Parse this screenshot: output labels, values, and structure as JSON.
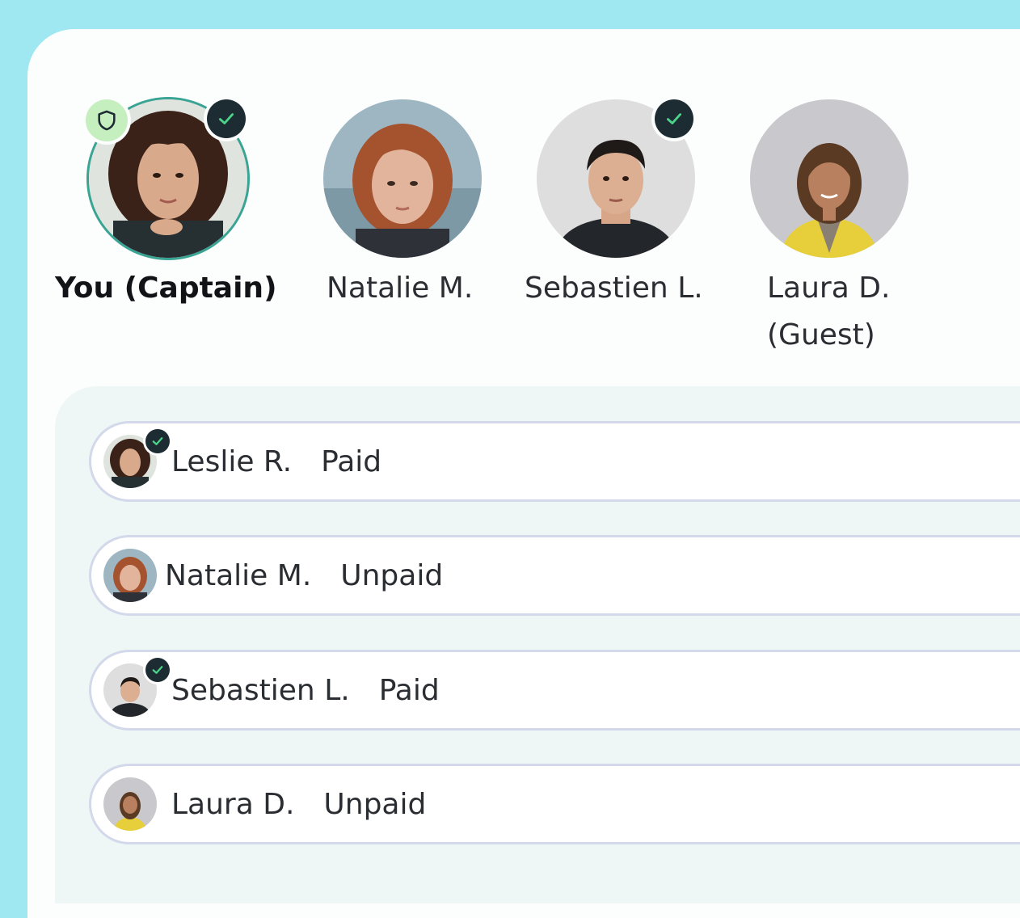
{
  "colors": {
    "frame": "#9fe8f1",
    "card": "#fcfdfd",
    "panel": "#eef7f6",
    "captain_ring": "#39a493",
    "badge_dark": "#1d2b33",
    "check": "#4cd38a",
    "shield_bg": "#c6efc0"
  },
  "members": [
    {
      "name": "You (Captain)",
      "verified": true,
      "captain": true,
      "icon": "shield-icon"
    },
    {
      "name": "Natalie M.",
      "verified": false
    },
    {
      "name": "Sebastien L.",
      "verified": true
    },
    {
      "name": "Laura D.",
      "name_line2": "(Guest)",
      "verified": false
    }
  ],
  "payments": [
    {
      "name": "Leslie R.",
      "status": "Paid",
      "verified": true
    },
    {
      "name": "Natalie M.",
      "status": "Unpaid",
      "verified": false
    },
    {
      "name": "Sebastien L.",
      "status": "Paid",
      "verified": true
    },
    {
      "name": "Laura D.",
      "status": "Unpaid",
      "verified": false
    }
  ]
}
